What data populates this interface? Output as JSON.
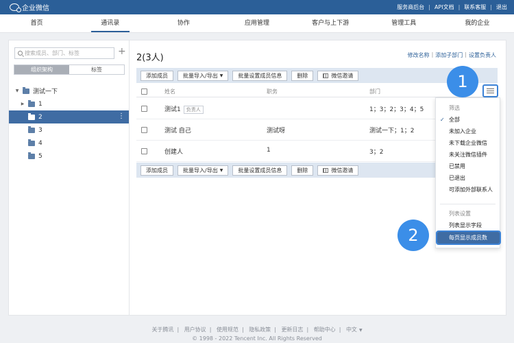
{
  "topbar": {
    "logo_text": "企业微信",
    "links": [
      "服务商后台",
      "API文档",
      "联系客服",
      "退出"
    ]
  },
  "nav": [
    "首页",
    "通讯录",
    "协作",
    "应用管理",
    "客户与上下游",
    "管理工具",
    "我的企业"
  ],
  "sidebar": {
    "search_placeholder": "搜索成员、部门、标签",
    "tabs": [
      "组织架构",
      "标签"
    ],
    "tree": [
      {
        "label": "测试一下"
      },
      {
        "label": "1"
      },
      {
        "label": "2"
      },
      {
        "label": "3"
      },
      {
        "label": "4"
      },
      {
        "label": "5"
      }
    ]
  },
  "main": {
    "title": "2(3人)",
    "links": [
      "修改名称",
      "添加子部门",
      "设置负责人"
    ],
    "toolbar": {
      "add": "添加成员",
      "import_export": "批量导入/导出",
      "batch_set": "批量设置成员信息",
      "delete": "删除",
      "invite": "微信邀请"
    },
    "columns": [
      "姓名",
      "职务",
      "部门"
    ],
    "rows": [
      {
        "name": "测试1",
        "tag": "负责人",
        "title": "",
        "dept": "1；3；2；3；4；5"
      },
      {
        "name": "测试 自己",
        "tag": "",
        "title": "测试呀",
        "dept": "测试一下；1；2"
      },
      {
        "name": "创建人",
        "tag": "",
        "title": "1",
        "dept": "3；2"
      }
    ]
  },
  "dropdown": {
    "filter_header": "筛选",
    "filters": [
      "全部",
      "未加入企业",
      "未下载企业微信",
      "未关注微信插件",
      "已禁用",
      "已退出",
      "可添加外部联系人"
    ],
    "list_header": "列表设置",
    "list_items": [
      "列表显示字段",
      "每页显示成员数"
    ]
  },
  "badges": [
    "1",
    "2"
  ],
  "footer": {
    "links": [
      "关于腾讯",
      "用户协议",
      "使用规范",
      "隐私政策",
      "更新日志",
      "帮助中心",
      "中文"
    ],
    "copyright": "© 1998 - 2022 Tencent Inc. All Rights Reserved"
  }
}
